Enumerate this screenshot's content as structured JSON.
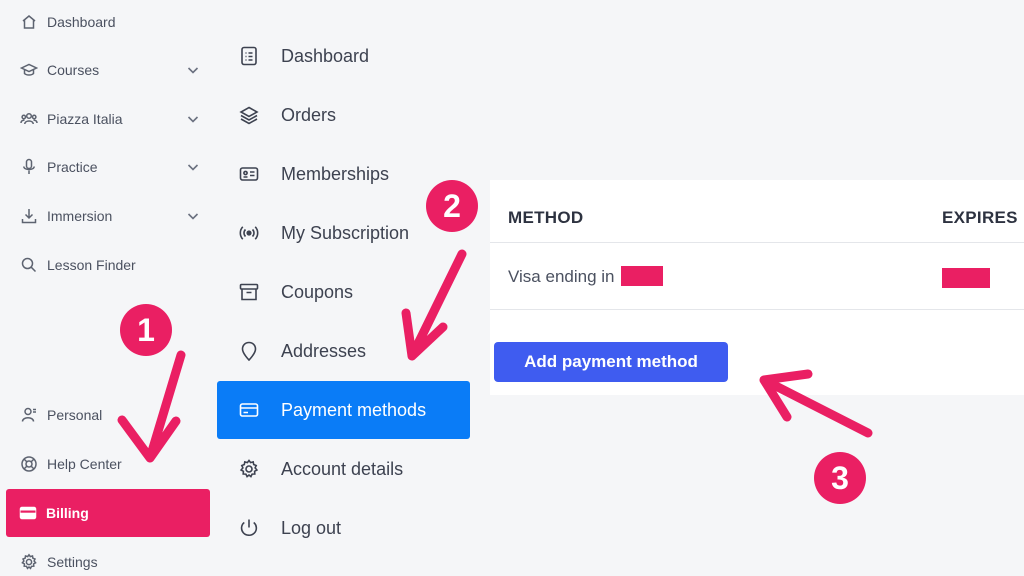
{
  "sidebar": {
    "items": [
      {
        "label": "Dashboard",
        "icon": "home-icon",
        "chevron": false
      },
      {
        "label": "Courses",
        "icon": "graduation-cap-icon",
        "chevron": true
      },
      {
        "label": "Piazza Italia",
        "icon": "users-icon",
        "chevron": true
      },
      {
        "label": "Practice",
        "icon": "microphone-icon",
        "chevron": true
      },
      {
        "label": "Immersion",
        "icon": "download-icon",
        "chevron": true
      },
      {
        "label": "Lesson Finder",
        "icon": "search-icon",
        "chevron": false
      },
      {
        "label": "Personal",
        "icon": "user-icon",
        "chevron": false
      },
      {
        "label": "Help Center",
        "icon": "lifebuoy-icon",
        "chevron": false
      },
      {
        "label": "Billing",
        "icon": "credit-card-icon",
        "chevron": false,
        "active": true
      },
      {
        "label": "Settings",
        "icon": "gear-icon",
        "chevron": false
      }
    ]
  },
  "account_menu": {
    "items": [
      {
        "label": "Dashboard",
        "icon": "document-list-icon"
      },
      {
        "label": "Orders",
        "icon": "layers-icon"
      },
      {
        "label": "Memberships",
        "icon": "id-card-icon"
      },
      {
        "label": "My Subscription",
        "icon": "broadcast-icon"
      },
      {
        "label": "Coupons",
        "icon": "archive-box-icon"
      },
      {
        "label": "Addresses",
        "icon": "map-pin-icon"
      },
      {
        "label": "Payment methods",
        "icon": "credit-card-icon",
        "active": true
      },
      {
        "label": "Account details",
        "icon": "gear-icon"
      },
      {
        "label": "Log out",
        "icon": "power-icon"
      }
    ]
  },
  "payment_methods": {
    "headers": {
      "method": "METHOD",
      "expires": "EXPIRES"
    },
    "rows": [
      {
        "method": "Visa ending in"
      }
    ],
    "add_button": "Add payment method"
  },
  "annotations": {
    "step1": "1",
    "step2": "2",
    "step3": "3"
  },
  "colors": {
    "accent_pink": "#ea1f63",
    "active_blue": "#0a7cf7",
    "button_blue": "#3f5cf0"
  }
}
